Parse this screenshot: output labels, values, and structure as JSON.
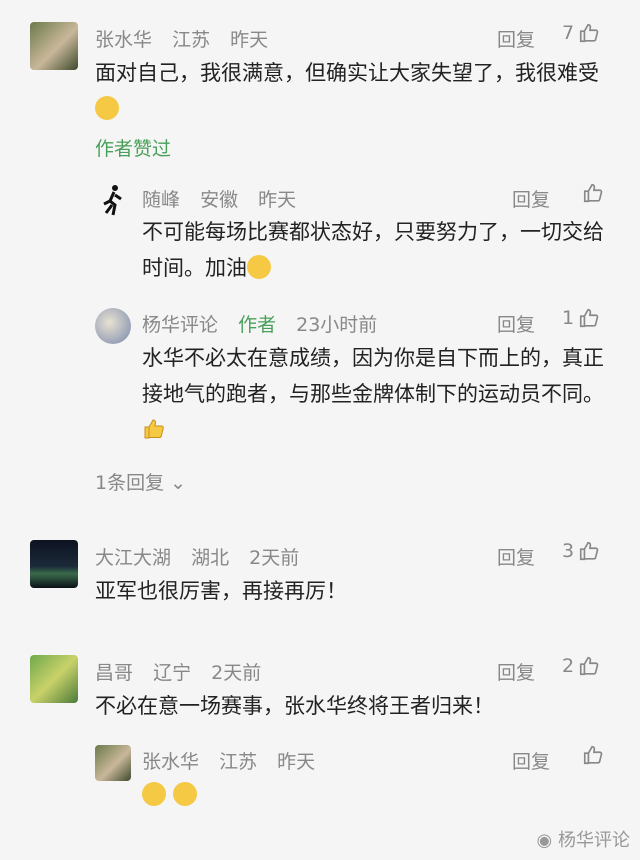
{
  "comments": [
    {
      "name": "张水华",
      "region": "江苏",
      "time": "昨天",
      "reply": "回复",
      "likes": "7",
      "text": "面对自己，我很满意，但确实让大家失望了，我很难受",
      "liked_by": "作者赞过"
    },
    {
      "name": "随峰",
      "region": "安徽",
      "time": "昨天",
      "reply": "回复",
      "likes": "",
      "text": "不可能每场比赛都状态好，只要努力了，一切交给时间。加油"
    },
    {
      "name": "杨华评论",
      "tag": "作者",
      "time": "23小时前",
      "reply": "回复",
      "likes": "1",
      "text": "水华不必太在意成绩，因为你是自下而上的，真正接地气的跑者，与那些金牌体制下的运动员不同。"
    },
    {
      "more": "1条回复"
    },
    {
      "name": "大江大湖",
      "region": "湖北",
      "time": "2天前",
      "reply": "回复",
      "likes": "3",
      "text": "亚军也很厉害，再接再厉！"
    },
    {
      "name": "昌哥",
      "region": "辽宁",
      "time": "2天前",
      "reply": "回复",
      "likes": "2",
      "text": "不必在意一场赛事，张水华终将王者归来！"
    },
    {
      "name": "张水华",
      "region": "江苏",
      "time": "昨天",
      "reply": "回复",
      "likes": ""
    }
  ],
  "watermark": "杨华评论"
}
